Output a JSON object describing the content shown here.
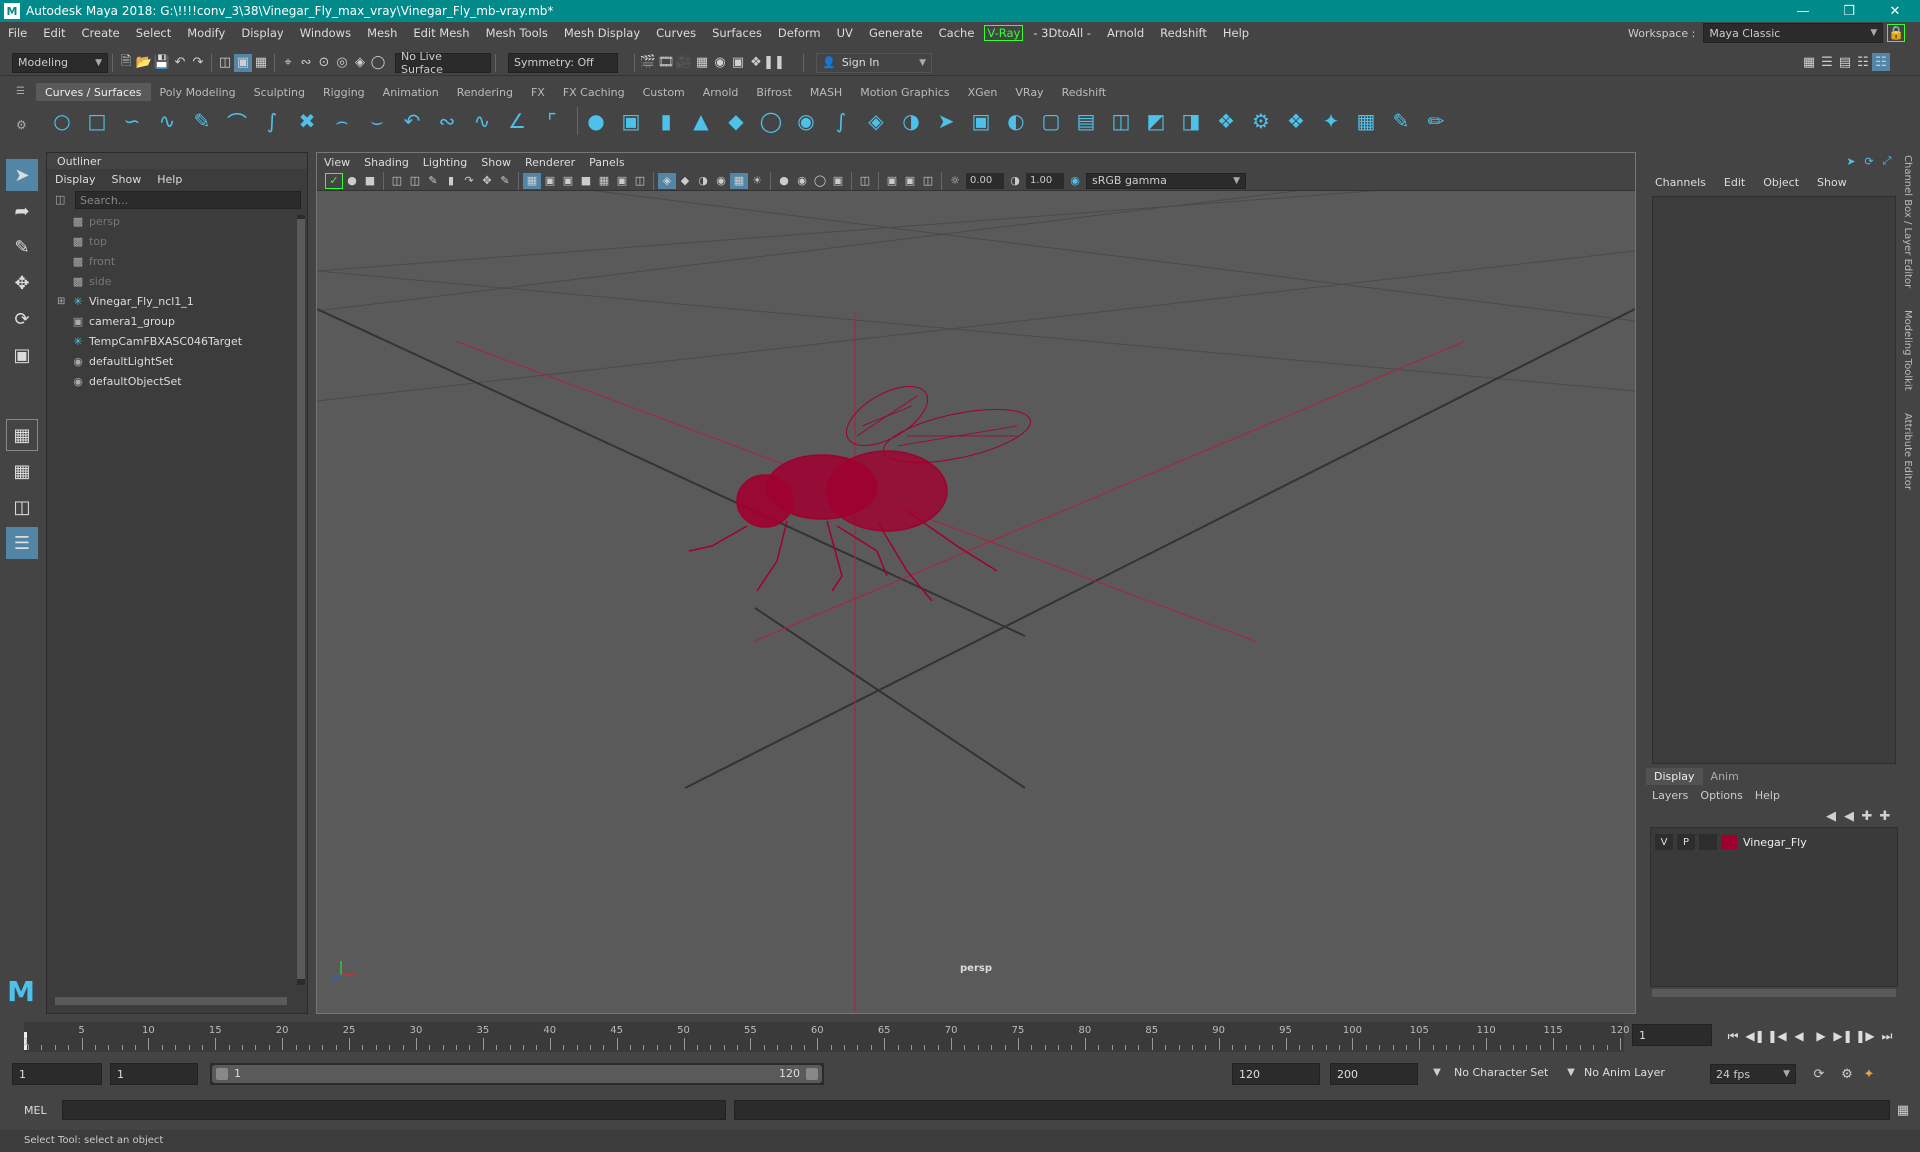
{
  "window": {
    "title": "Autodesk Maya 2018: G:\\!!!!conv_3\\38\\Vinegar_Fly_max_vray\\Vinegar_Fly_mb-vray.mb*"
  },
  "menubar": {
    "items": [
      "File",
      "Edit",
      "Create",
      "Select",
      "Modify",
      "Display",
      "Windows",
      "Mesh",
      "Edit Mesh",
      "Mesh Tools",
      "Mesh Display",
      "Curves",
      "Surfaces",
      "Deform",
      "UV",
      "Generate",
      "Cache"
    ],
    "vray": "V-Ray",
    "items2": [
      "- 3DtoAll -",
      "Arnold",
      "Redshift",
      "Help"
    ],
    "workspace_label": "Workspace :",
    "workspace_value": "Maya Classic"
  },
  "statusline": {
    "mode": "Modeling",
    "live_surface": "No Live Surface",
    "symmetry": "Symmetry: Off",
    "sign_in": "Sign In"
  },
  "shelf": {
    "tabs": [
      "Curves / Surfaces",
      "Poly Modeling",
      "Sculpting",
      "Rigging",
      "Animation",
      "Rendering",
      "FX",
      "FX Caching",
      "Custom",
      "Arnold",
      "Bifrost",
      "MASH",
      "Motion Graphics",
      "XGen",
      "VRay",
      "Redshift"
    ],
    "active_tab": "Curves / Surfaces"
  },
  "outliner": {
    "title": "Outliner",
    "menu": [
      "Display",
      "Show",
      "Help"
    ],
    "search_placeholder": "Search...",
    "items": [
      {
        "label": "persp",
        "icon": "camera-icon",
        "dim": true
      },
      {
        "label": "top",
        "icon": "camera-icon",
        "dim": true
      },
      {
        "label": "front",
        "icon": "camera-icon",
        "dim": true
      },
      {
        "label": "side",
        "icon": "camera-icon",
        "dim": true
      },
      {
        "label": "Vinegar_Fly_ncl1_1",
        "icon": "joint-star-icon",
        "dim": false,
        "expandable": true
      },
      {
        "label": "camera1_group",
        "icon": "group-icon",
        "dim": false
      },
      {
        "label": "TempCamFBXASC046Target",
        "icon": "joint-star-icon",
        "dim": false
      },
      {
        "label": "defaultLightSet",
        "icon": "set-icon",
        "dim": false
      },
      {
        "label": "defaultObjectSet",
        "icon": "set-icon",
        "dim": false
      }
    ]
  },
  "viewport": {
    "menu": [
      "View",
      "Shading",
      "Lighting",
      "Show",
      "Renderer",
      "Panels"
    ],
    "exposure": "0.00",
    "gamma": "1.00",
    "color_space": "sRGB gamma",
    "camera_label": "persp",
    "model_color": "#a00030",
    "axis_color": "#b0203c"
  },
  "channelbox": {
    "menu": [
      "Channels",
      "Edit",
      "Object",
      "Show"
    ],
    "side_tabs": [
      "Channel Box / Layer Editor",
      "Modeling Toolkit",
      "Attribute Editor"
    ]
  },
  "layereditor": {
    "tabs": [
      "Display",
      "Anim"
    ],
    "menu": [
      "Layers",
      "Options",
      "Help"
    ],
    "layer": {
      "v": "V",
      "p": "P",
      "name": "Vinegar_Fly",
      "color": "#a00030"
    }
  },
  "timeslider": {
    "labels": [
      "5",
      "10",
      "15",
      "20",
      "25",
      "30",
      "35",
      "40",
      "45",
      "50",
      "55",
      "60",
      "65",
      "70",
      "75",
      "80",
      "85",
      "90",
      "95",
      "100",
      "105",
      "110",
      "115",
      "120"
    ],
    "start_label": "1",
    "current_frame": "1"
  },
  "rangeslider": {
    "start": "1",
    "playback_start": "1",
    "range_start": "1",
    "range_end": "120",
    "playback_end": "120",
    "end": "200",
    "character_set": "No Character Set",
    "anim_layer": "No Anim Layer",
    "fps": "24 fps"
  },
  "cmdline": {
    "label": "MEL"
  },
  "helpline": {
    "text": "Select Tool: select an object"
  }
}
